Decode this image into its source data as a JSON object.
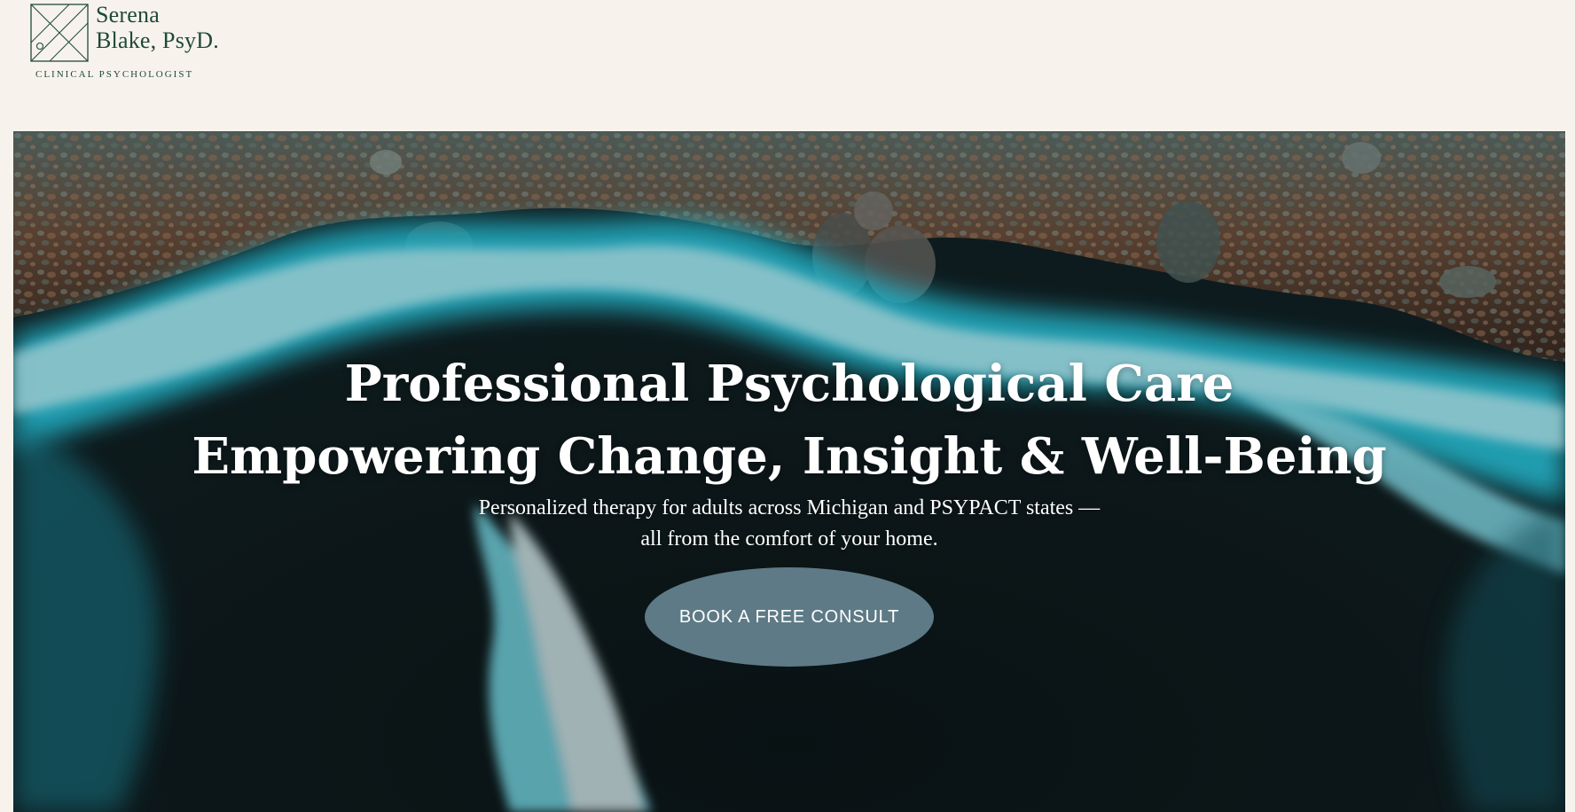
{
  "header": {
    "logo_name_line1": "Serena",
    "logo_name_line2": "Blake, PsyD.",
    "logo_subtitle": "CLINICAL PSYCHOLOGIST",
    "logo_icon": "geometric-x-square-icon"
  },
  "hero": {
    "title_line1": "Professional Psychological Care",
    "title_line2": "Empowering Change, Insight & Well-Being",
    "subtitle": "Personalized therapy for adults across Michigan and PSYPACT states — all from the comfort of your home.",
    "cta_label": "BOOK A FREE CONSULT",
    "background": "aerial-ocean-waves-rocky-shore"
  },
  "colors": {
    "page_background": "#f7f3ec",
    "brand_green": "#1f4a38",
    "cta_background": "#5e7a86",
    "hero_text": "#ffffff"
  }
}
